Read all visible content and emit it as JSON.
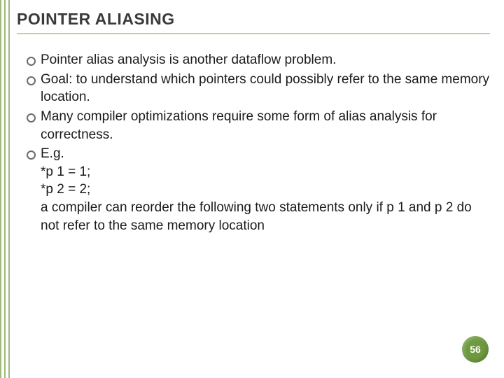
{
  "title": "POINTER ALIASING",
  "bullets": [
    {
      "text": "Pointer alias analysis is another dataflow problem."
    },
    {
      "text": "Goal: to understand which pointers could possibly refer to the same memory location."
    },
    {
      "text": "Many compiler optimizations require some form of alias analysis for correctness."
    },
    {
      "text": "E.g.",
      "sublines": [
        "*p 1 = 1;",
        "*p 2 = 2;",
        "a compiler can reorder the following two statements only if p 1 and p 2 do not refer to the same memory location"
      ]
    }
  ],
  "page_number": "56"
}
